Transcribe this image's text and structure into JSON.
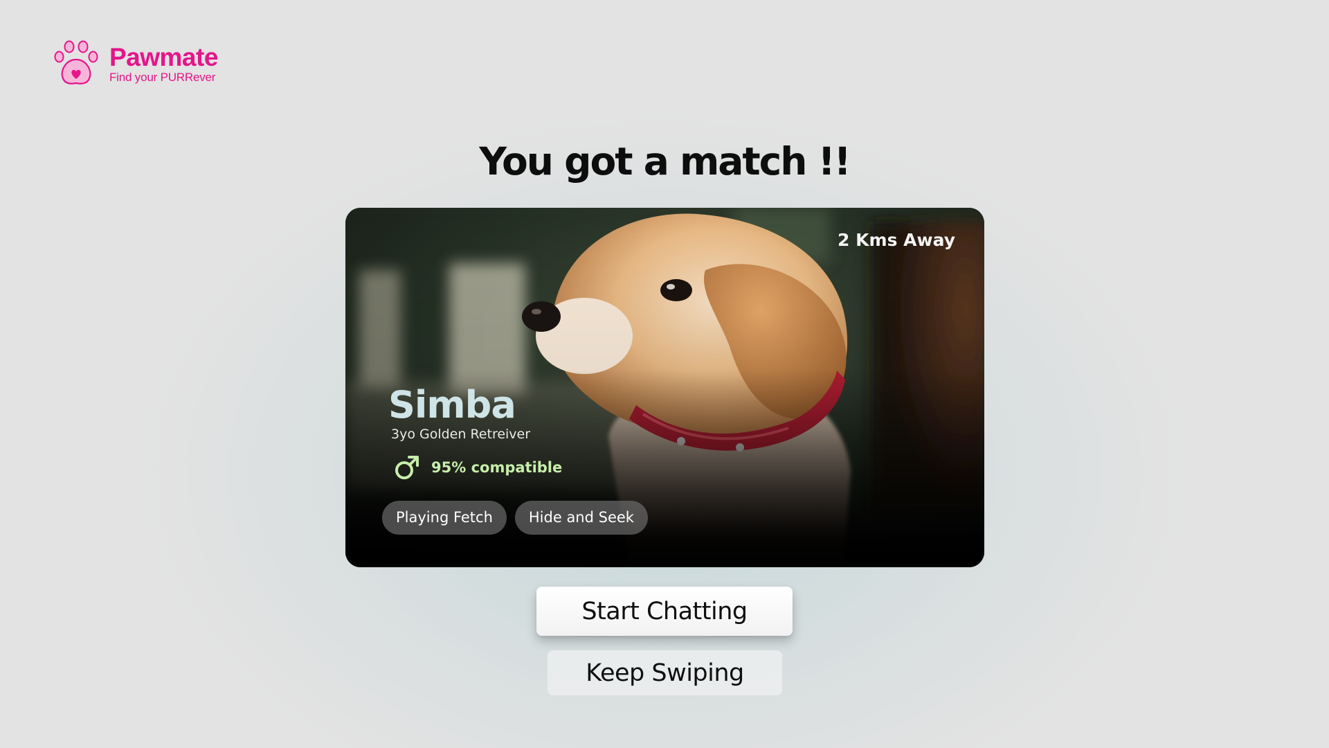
{
  "app": {
    "name": "Pawmate",
    "tagline": "Find your PURRever",
    "brand_color": "#e5158a",
    "logo_icon": "paw-heart-icon"
  },
  "match": {
    "heading": "You got a match !!"
  },
  "profile": {
    "distance": "2 Kms Away",
    "name": "Simba",
    "description": "3yo Golden Retreiver",
    "gender_icon": "male-icon",
    "compatibility": "95% compatible",
    "compatibility_color": "#c7eeaa",
    "interests": [
      "Playing Fetch",
      "Hide and Seek"
    ],
    "photo": "golden-retriever-puppy-photo"
  },
  "actions": {
    "primary_label": "Start Chatting",
    "secondary_label": "Keep Swiping"
  }
}
